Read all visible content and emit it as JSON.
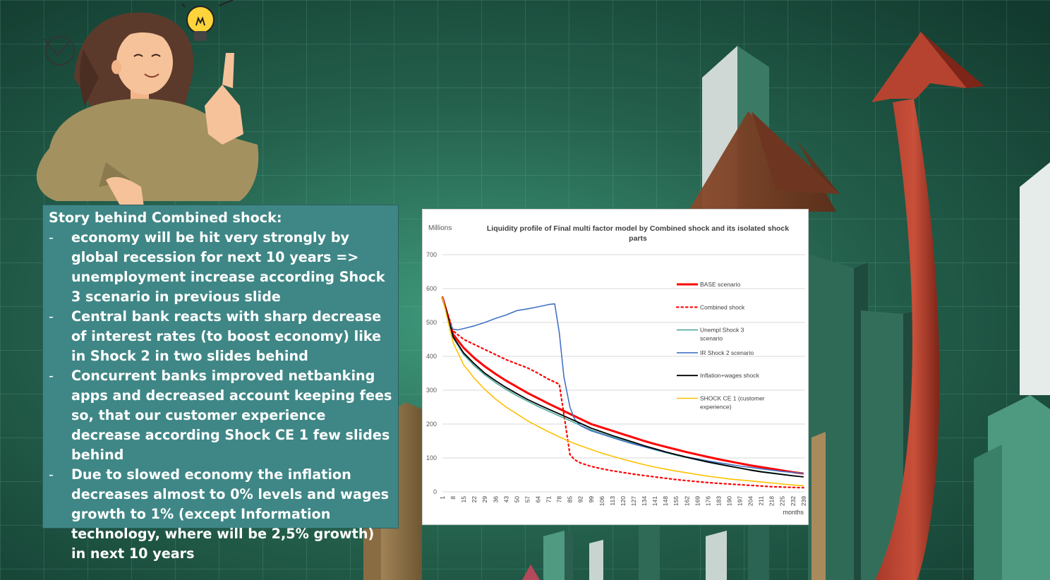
{
  "story": {
    "heading": "Story behind Combined shock:",
    "bullets": [
      "economy will be hit very strongly by global recession for next 10 years => unemployment increase according Shock 3 scenario in previous slide",
      "Central bank reacts with sharp decrease of interest rates (to boost economy) like in Shock 2 in two slides behind",
      "Concurrent banks improved netbanking apps and decreased account keeping fees so, that our customer experience decrease according Shock CE 1 few slides behind",
      "Due to slowed economy the inflation decreases almost to 0% levels and wages growth to 1% (except Information technology, where will be 2,5% growth) in next 10 years"
    ]
  },
  "chart_data": {
    "type": "line",
    "title": "Liquidity profile of Final multi factor model by Combined shock and its isolated shock parts",
    "units_label": "Millions",
    "xlabel": "months",
    "ylabel": "",
    "ylim": [
      0,
      700
    ],
    "yticks": [
      0,
      100,
      200,
      300,
      400,
      500,
      600,
      700
    ],
    "xlim": [
      1,
      240
    ],
    "xticks": [
      1,
      8,
      15,
      22,
      29,
      36,
      43,
      50,
      57,
      64,
      71,
      78,
      85,
      92,
      99,
      106,
      113,
      120,
      127,
      134,
      141,
      148,
      155,
      162,
      169,
      176,
      183,
      190,
      197,
      204,
      211,
      218,
      225,
      232,
      239
    ],
    "grid": "horizontal",
    "legend_position": "right",
    "series": [
      {
        "name": "BASE scenario",
        "color": "#ff0000",
        "dash": "solid",
        "width": 3,
        "x": [
          1,
          8,
          15,
          22,
          29,
          36,
          43,
          50,
          57,
          64,
          71,
          78,
          85,
          92,
          99,
          106,
          113,
          120,
          127,
          134,
          141,
          148,
          155,
          162,
          169,
          176,
          183,
          190,
          197,
          204,
          211,
          218,
          225,
          232,
          239
        ],
        "y": [
          575,
          465,
          425,
          395,
          370,
          348,
          328,
          310,
          292,
          276,
          260,
          245,
          230,
          215,
          200,
          190,
          180,
          170,
          160,
          150,
          141,
          133,
          125,
          117,
          110,
          103,
          96,
          90,
          84,
          78,
          73,
          68,
          63,
          58,
          54
        ]
      },
      {
        "name": "Combined shock",
        "color": "#ff0000",
        "dash": "dotted",
        "width": 2.2,
        "x": [
          1,
          8,
          15,
          22,
          29,
          36,
          43,
          50,
          57,
          64,
          71,
          78,
          82,
          85,
          88,
          92,
          99,
          106,
          113,
          120,
          127,
          134,
          141,
          148,
          155,
          162,
          169,
          176,
          183,
          190,
          197,
          204,
          211,
          218,
          225,
          232,
          239
        ],
        "y": [
          575,
          475,
          450,
          435,
          420,
          405,
          390,
          378,
          366,
          350,
          332,
          318,
          200,
          110,
          95,
          85,
          75,
          68,
          62,
          57,
          52,
          48,
          44,
          40,
          36,
          33,
          30,
          27,
          25,
          23,
          21,
          19,
          17,
          15,
          14,
          13,
          12
        ]
      },
      {
        "name": "Unempl Shock 3 scenario",
        "color": "#4aa89c",
        "dash": "solid",
        "width": 1.6,
        "x": [
          1,
          8,
          15,
          22,
          29,
          36,
          43,
          50,
          57,
          64,
          71,
          78,
          85,
          92,
          99,
          106,
          113,
          120,
          127,
          134,
          141,
          148,
          155,
          162,
          169,
          176,
          183,
          190,
          197,
          204,
          211,
          218,
          225,
          232,
          239
        ],
        "y": [
          575,
          455,
          405,
          372,
          345,
          322,
          302,
          284,
          268,
          252,
          238,
          224,
          210,
          196,
          183,
          172,
          162,
          152,
          142,
          133,
          124,
          116,
          108,
          101,
          94,
          87,
          81,
          75,
          70,
          65,
          60,
          56,
          52,
          48,
          44
        ]
      },
      {
        "name": "IR Shock 2 scenario",
        "color": "#4472c4",
        "dash": "solid",
        "width": 1.6,
        "x": [
          1,
          5,
          8,
          11,
          15,
          22,
          29,
          36,
          43,
          50,
          57,
          64,
          71,
          75,
          78,
          81,
          85,
          88,
          92,
          99,
          106,
          113,
          120,
          127,
          134,
          141,
          148,
          155,
          162,
          169,
          176,
          183,
          190,
          197,
          204,
          211,
          218,
          225,
          232,
          239
        ],
        "y": [
          575,
          505,
          480,
          478,
          482,
          490,
          500,
          512,
          522,
          535,
          540,
          546,
          553,
          555,
          470,
          340,
          250,
          215,
          195,
          180,
          170,
          160,
          150,
          141,
          133,
          125,
          117,
          110,
          103,
          97,
          91,
          86,
          81,
          76,
          72,
          68,
          64,
          60,
          57,
          54
        ]
      },
      {
        "name": "Inflation+wages shock",
        "color": "#000000",
        "dash": "solid",
        "width": 1.8,
        "x": [
          1,
          8,
          15,
          22,
          29,
          36,
          43,
          50,
          57,
          64,
          71,
          78,
          85,
          92,
          99,
          106,
          113,
          120,
          127,
          134,
          141,
          148,
          155,
          162,
          169,
          176,
          183,
          190,
          197,
          204,
          211,
          218,
          225,
          232,
          239
        ],
        "y": [
          575,
          458,
          410,
          378,
          350,
          328,
          308,
          290,
          273,
          258,
          244,
          230,
          216,
          202,
          188,
          177,
          166,
          156,
          146,
          136,
          127,
          118,
          110,
          102,
          95,
          88,
          82,
          76,
          70,
          64,
          59,
          55,
          51,
          47,
          44
        ]
      },
      {
        "name": "SHOCK CE 1 (customer experience)",
        "color": "#ffc000",
        "dash": "solid",
        "width": 1.6,
        "x": [
          1,
          8,
          15,
          22,
          29,
          36,
          43,
          50,
          57,
          64,
          71,
          78,
          85,
          92,
          99,
          106,
          113,
          120,
          127,
          134,
          141,
          148,
          155,
          162,
          169,
          176,
          183,
          190,
          197,
          204,
          211,
          218,
          225,
          232,
          239
        ],
        "y": [
          575,
          440,
          375,
          335,
          302,
          274,
          250,
          230,
          210,
          193,
          177,
          162,
          148,
          136,
          125,
          114,
          105,
          96,
          88,
          80,
          73,
          67,
          61,
          56,
          51,
          46,
          42,
          38,
          35,
          32,
          29,
          26,
          23,
          20,
          18
        ]
      }
    ]
  }
}
